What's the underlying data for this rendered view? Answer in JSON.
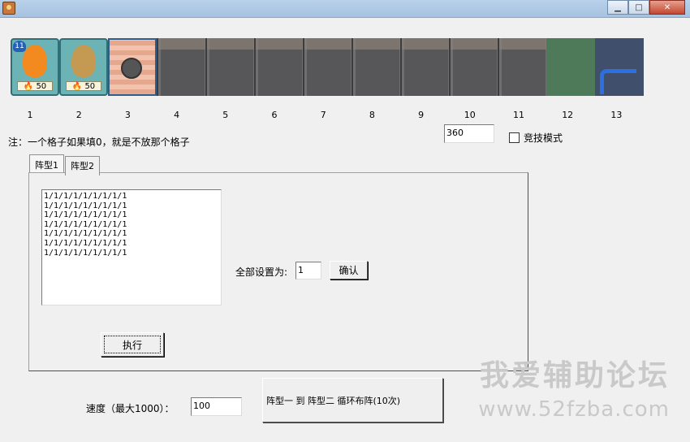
{
  "window": {
    "minimize_glyph": "▁",
    "maximize_glyph": "□",
    "close_glyph": "✕"
  },
  "cards": [
    {
      "type": "seed",
      "icon": "fire-plant-icon",
      "badge": "11",
      "cost": "🔥 50",
      "color": "#f28a1f"
    },
    {
      "type": "seed",
      "icon": "potato-plant-icon",
      "cost": "🔥 50",
      "color": "#c49a52"
    },
    {
      "type": "shovel",
      "icon": "frying-pan-icon"
    },
    {
      "type": "blank"
    },
    {
      "type": "blank"
    },
    {
      "type": "blank"
    },
    {
      "type": "blank"
    },
    {
      "type": "blank"
    },
    {
      "type": "blank"
    },
    {
      "type": "blank"
    },
    {
      "type": "blank"
    },
    {
      "type": "green"
    },
    {
      "type": "blue"
    }
  ],
  "slot_numbers": [
    "1",
    "2",
    "3",
    "4",
    "5",
    "6",
    "7",
    "8",
    "9",
    "10",
    "11",
    "12",
    "13"
  ],
  "note": "注：一个格子如果填0，就是不放那个格子",
  "top_value": "360",
  "competitive_mode_label": "竞技模式",
  "tabs": [
    "阵型1",
    "阵型2"
  ],
  "formation_text": "1/1/1/1/1/1/1/1/1\n1/1/1/1/1/1/1/1/1\n1/1/1/1/1/1/1/1/1\n1/1/1/1/1/1/1/1/1\n1/1/1/1/1/1/1/1/1\n1/1/1/1/1/1/1/1/1\n1/1/1/1/1/1/1/1/1",
  "set_all_label": "全部设置为:",
  "set_all_value": "1",
  "confirm_label": "确认",
  "execute_label": "执行",
  "speed_label": "速度（最大1000）：",
  "speed_value": "100",
  "cycle_button_label": "阵型一 到 阵型二 循环布阵(10次)",
  "watermark_line1": "我爱辅助论坛",
  "watermark_line2": "www.52fzba.com"
}
